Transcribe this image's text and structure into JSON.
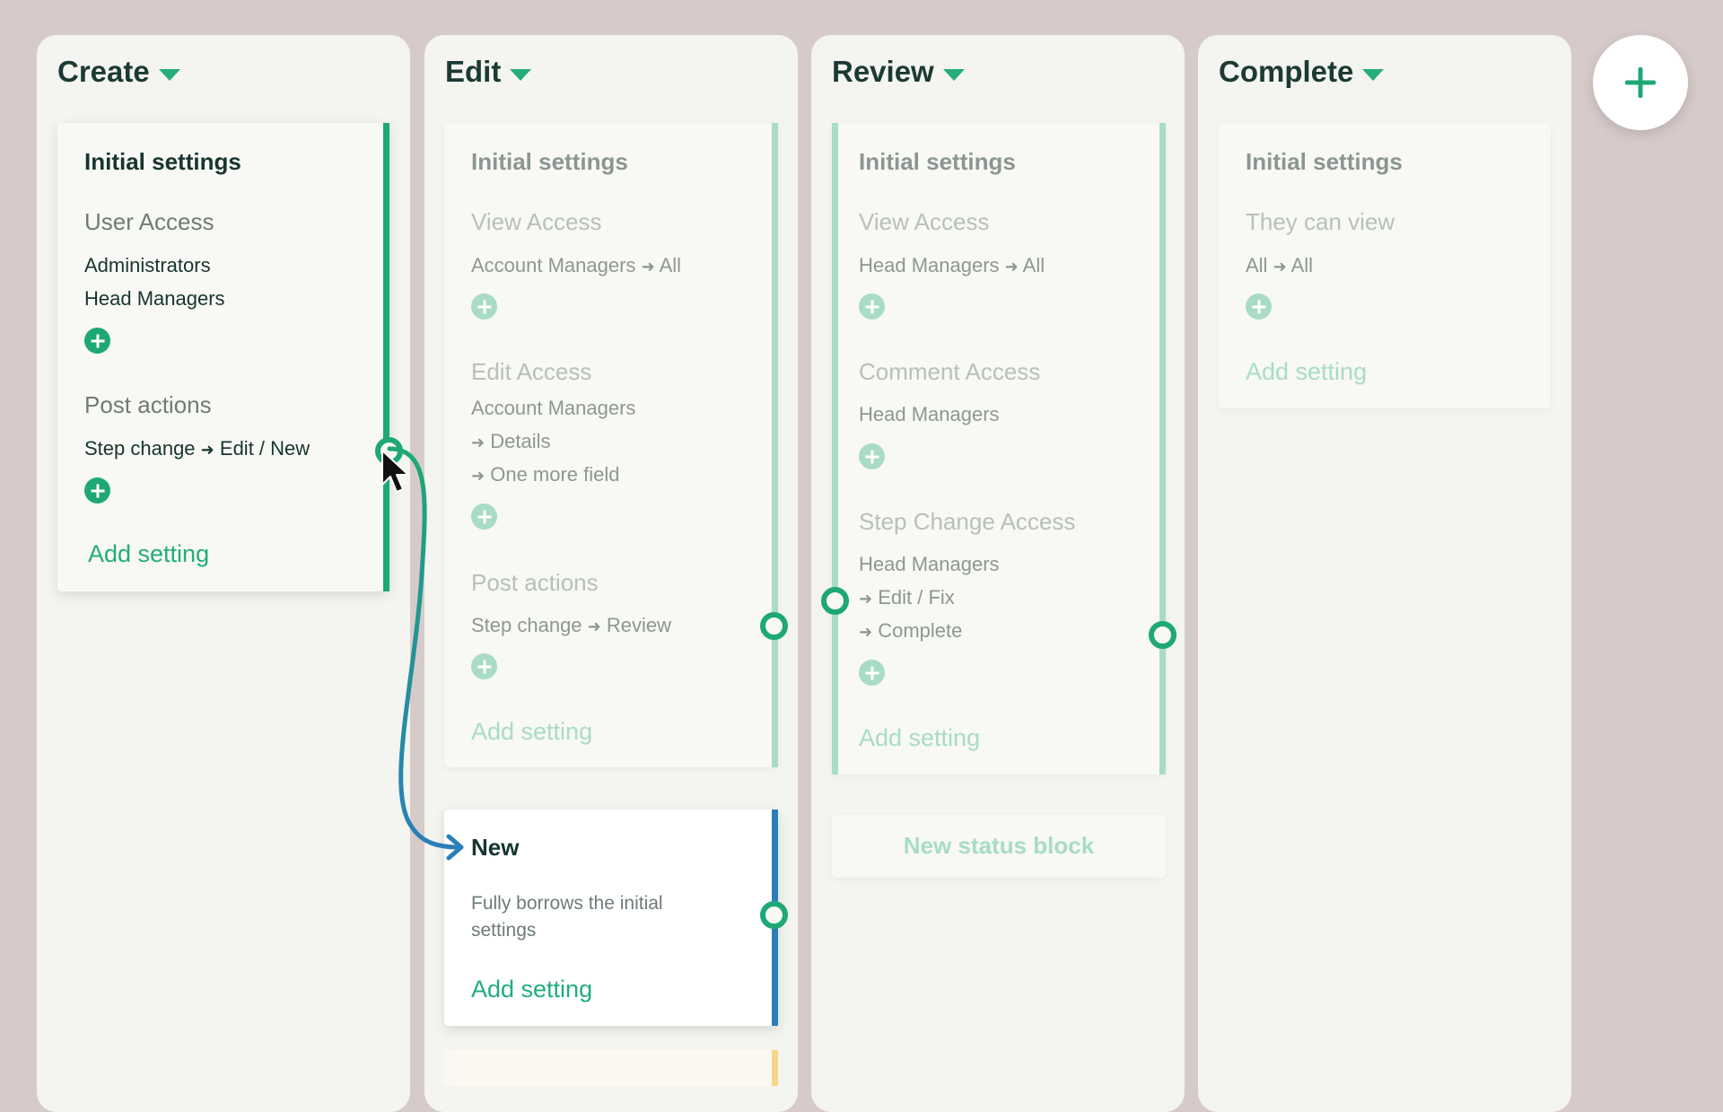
{
  "add_column_label": "+",
  "columns": [
    {
      "title": "Create",
      "card": {
        "heading": "Initial settings",
        "section1": "User Access",
        "section1_items": [
          "Administrators",
          "Head Managers"
        ],
        "section2": "Post actions",
        "section2_item_prefix": "Step change",
        "section2_item_suffix": "Edit / New",
        "add_setting": "Add setting"
      }
    },
    {
      "title": "Edit",
      "card": {
        "heading": "Initial settings",
        "section1": "View Access",
        "section1_item_prefix": "Account Managers",
        "section1_item_suffix": "All",
        "section2": "Edit Access",
        "section2_items": [
          "Account Managers",
          "Details",
          "One more field"
        ],
        "section3": "Post actions",
        "section3_item_prefix": "Step change",
        "section3_item_suffix": "Review",
        "add_setting": "Add setting"
      },
      "card2": {
        "heading": "New",
        "description": "Fully borrows the initial settings",
        "add_setting": "Add setting"
      }
    },
    {
      "title": "Review",
      "card": {
        "heading": "Initial settings",
        "section1": "View Access",
        "section1_item_prefix": "Head Managers",
        "section1_item_suffix": "All",
        "section2": "Comment Access",
        "section2_items": [
          "Head Managers"
        ],
        "section3": "Step Change Access",
        "section3_items": [
          "Head Managers",
          "Edit / Fix",
          "Complete"
        ],
        "add_setting": "Add setting"
      },
      "new_block": "New status block"
    },
    {
      "title": "Complete",
      "card": {
        "heading": "Initial settings",
        "section1": "They can view",
        "section1_item_prefix": "All",
        "section1_item_suffix": "All",
        "add_setting": "Add setting"
      }
    }
  ],
  "colors": {
    "accent": "#1ea875",
    "accent_soft": "#a9dcc6",
    "link_blue": "#2a7fb8",
    "background": "#d7cbca",
    "column": "#f4f4f0"
  }
}
